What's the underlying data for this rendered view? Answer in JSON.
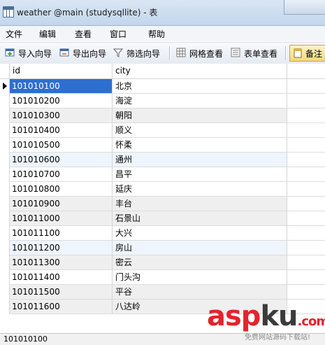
{
  "window": {
    "title": "weather @main (studysqllite) - 表"
  },
  "menu": [
    "文件",
    "编辑",
    "查看",
    "窗口",
    "帮助"
  ],
  "toolbar": {
    "import_wizard": "导入向导",
    "export_wizard": "导出向导",
    "filter_wizard": "筛选向导",
    "grid_view": "网格查看",
    "form_view": "表单查看",
    "note": "备注"
  },
  "table": {
    "columns": [
      "id",
      "city"
    ],
    "rows": [
      [
        "101010100",
        "北京"
      ],
      [
        "101010200",
        "海淀"
      ],
      [
        "101010300",
        "朝阳"
      ],
      [
        "101010400",
        "顺义"
      ],
      [
        "101010500",
        "怀柔"
      ],
      [
        "101010600",
        "通州"
      ],
      [
        "101010700",
        "昌平"
      ],
      [
        "101010800",
        "延庆"
      ],
      [
        "101010900",
        "丰台"
      ],
      [
        "101011000",
        "石景山"
      ],
      [
        "101011100",
        "大兴"
      ],
      [
        "101011200",
        "房山"
      ],
      [
        "101011300",
        "密云"
      ],
      [
        "101011400",
        "门头沟"
      ],
      [
        "101011500",
        "平谷"
      ],
      [
        "101011600",
        "八达岭"
      ]
    ]
  },
  "status": {
    "value": "101010100"
  },
  "watermark": {
    "brand_red": "asp",
    "brand_dark": "ku",
    "brand_suffix": ".com",
    "tagline": "免费网站源码下载站!"
  },
  "colors": {
    "selection": "#2d6fd1",
    "brand_red": "#e4232b"
  }
}
